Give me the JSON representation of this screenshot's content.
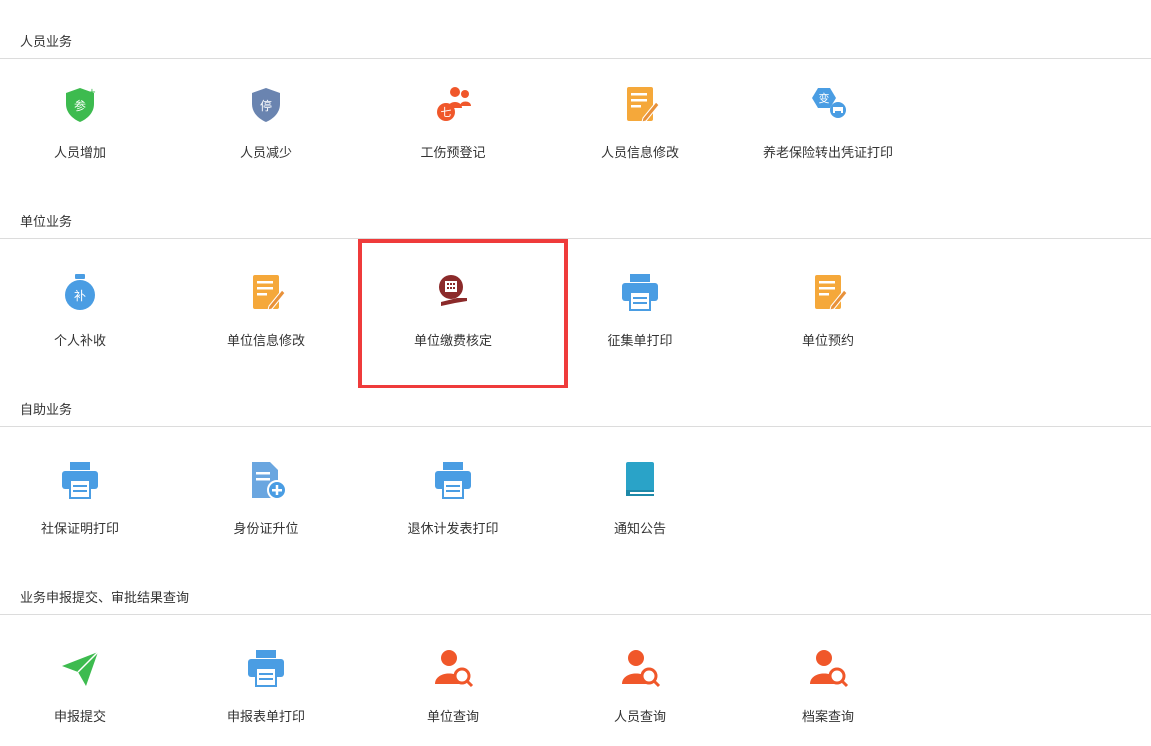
{
  "sections": [
    {
      "title": "人员业务",
      "tiles": [
        {
          "label": "人员增加",
          "icon": "shield-add-icon",
          "glyph": "参"
        },
        {
          "label": "人员减少",
          "icon": "shield-stop-icon",
          "glyph": "停"
        },
        {
          "label": "工伤预登记",
          "icon": "people-icon"
        },
        {
          "label": "人员信息修改",
          "icon": "edit-document-icon"
        },
        {
          "label": "养老保险转出凭证打印",
          "icon": "change-print-icon",
          "glyph": "变"
        }
      ]
    },
    {
      "title": "单位业务",
      "tiles": [
        {
          "label": "个人补收",
          "icon": "money-bag-icon",
          "glyph": "补"
        },
        {
          "label": "单位信息修改",
          "icon": "edit-document-icon"
        },
        {
          "label": "单位缴费核定",
          "icon": "calculator-hand-icon"
        },
        {
          "label": "征集单打印",
          "icon": "printer-icon"
        },
        {
          "label": "单位预约",
          "icon": "edit-document-icon"
        }
      ]
    },
    {
      "title": "自助业务",
      "tiles": [
        {
          "label": "社保证明打印",
          "icon": "printer-icon"
        },
        {
          "label": "身份证升位",
          "icon": "document-add-icon"
        },
        {
          "label": "退休计发表打印",
          "icon": "printer-icon"
        },
        {
          "label": "通知公告",
          "icon": "book-icon"
        }
      ]
    },
    {
      "title": "业务申报提交、审批结果查询",
      "tiles": [
        {
          "label": "申报提交",
          "icon": "paper-plane-icon"
        },
        {
          "label": "申报表单打印",
          "icon": "printer-icon"
        },
        {
          "label": "单位查询",
          "icon": "person-search-icon"
        },
        {
          "label": "人员查询",
          "icon": "person-search-icon"
        },
        {
          "label": "档案查询",
          "icon": "person-search-icon"
        }
      ]
    }
  ],
  "colors": {
    "green": "#3dbb4f",
    "shield_blue": "#6a84b0",
    "orange_red": "#f0572a",
    "orange": "#f5a83a",
    "blue": "#4a9de3",
    "maroon": "#8b2a2a",
    "highlight": "#ef3b3b"
  }
}
